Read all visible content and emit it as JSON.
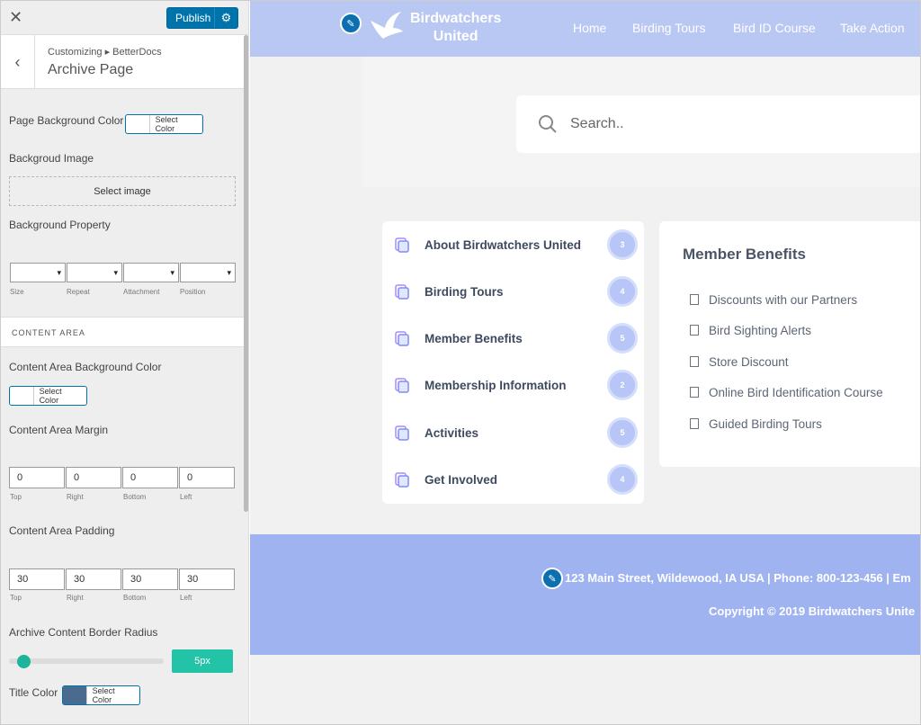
{
  "customizer": {
    "publish_label": "Publish",
    "breadcrumb": "Customizing ▸ BetterDocs",
    "title": "Archive Page",
    "page_bg_label": "Page Background Color",
    "select_color": "Select Color",
    "bg_image_label": "Backgroud Image",
    "select_image": "Select image",
    "bg_property_label": "Background Property",
    "bg_property_fields": [
      "Size",
      "Repeat",
      "Attachment",
      "Position"
    ],
    "content_area_section": "CONTENT AREA",
    "content_bg_label": "Content Area Background Color",
    "content_margin_label": "Content Area Margin",
    "margin": {
      "top": "0",
      "right": "0",
      "bottom": "0",
      "left": "0"
    },
    "content_padding_label": "Content Area Padding",
    "padding": {
      "top": "30",
      "right": "30",
      "bottom": "30",
      "left": "30"
    },
    "side_labels": [
      "Top",
      "Right",
      "Bottom",
      "Left"
    ],
    "border_radius_label": "Archive Content Border Radius",
    "border_radius_value": "5px",
    "border_radius_fraction": 0.05,
    "title_color_label": "Title Color"
  },
  "site": {
    "logo_line1": "Birdwatchers",
    "logo_line2": "United",
    "nav": [
      "Home",
      "Birding Tours",
      "Bird ID Course",
      "Take Action"
    ],
    "search_placeholder": "Search.."
  },
  "categories": [
    {
      "name": "About Birdwatchers United",
      "count": "3"
    },
    {
      "name": "Birding Tours",
      "count": "4"
    },
    {
      "name": "Member Benefits",
      "count": "5"
    },
    {
      "name": "Membership Information",
      "count": "2"
    },
    {
      "name": "Activities",
      "count": "5"
    },
    {
      "name": "Get Involved",
      "count": "4"
    }
  ],
  "benefits": {
    "title": "Member Benefits",
    "items": [
      "Discounts with our Partners",
      "Bird Sighting Alerts",
      "Store Discount",
      "Online Bird Identification Course",
      "Guided Birding Tours"
    ]
  },
  "footer": {
    "address": "123 Main Street, Wildewood, IA USA | Phone: 800-123-456 | Em",
    "copyright": "Copyright © 2019 Birdwatchers Unite"
  },
  "colors": {
    "accent": "#0073aa",
    "slider": "#22c3a6",
    "nav_bg": "#b9c7f3",
    "footer_bg": "#9fb3f1",
    "title_color_swatch": "#4a6b8f"
  }
}
